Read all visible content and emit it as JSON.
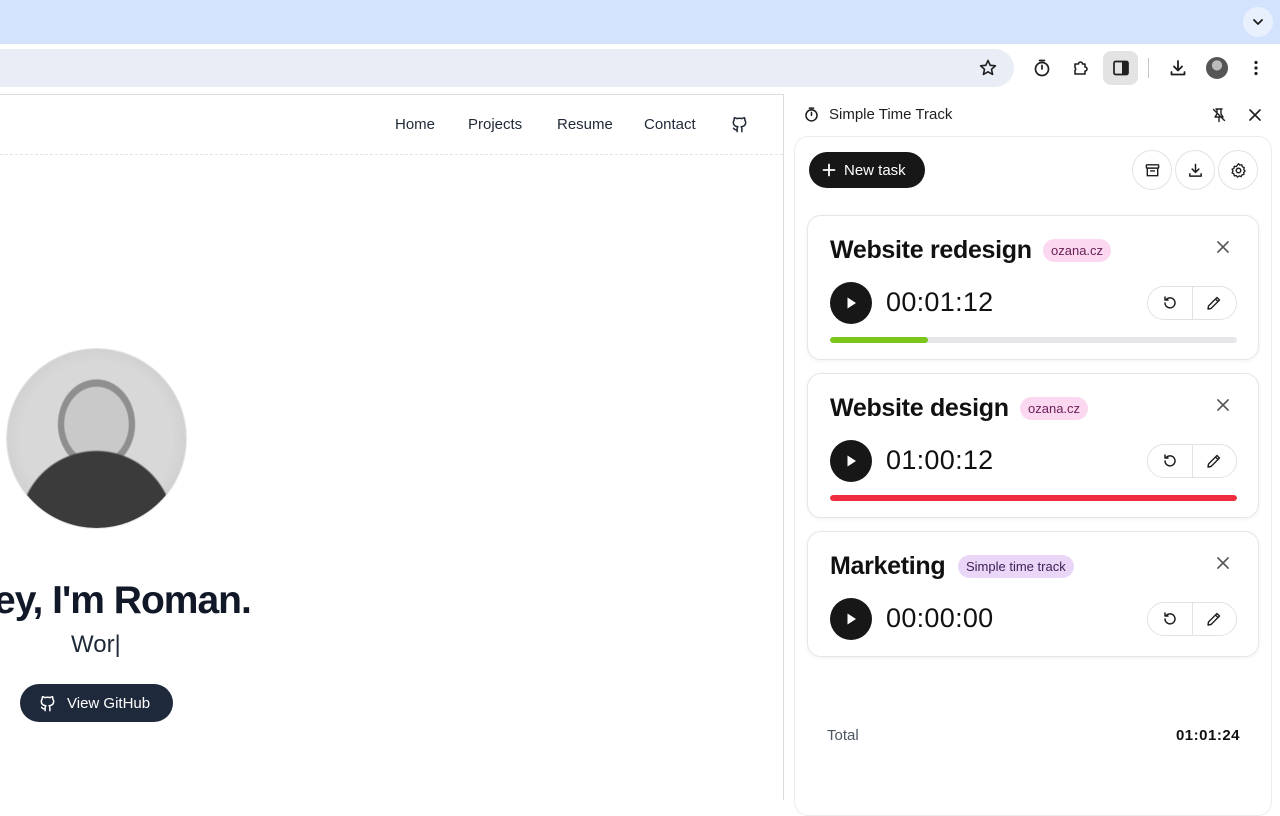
{
  "browser": {
    "toolbar_icons": [
      "star-icon",
      "timer-icon",
      "extensions-icon",
      "side-panel-icon",
      "download-icon",
      "profile-avatar",
      "more-icon"
    ]
  },
  "website": {
    "nav": [
      "Home",
      "Projects",
      "Resume",
      "Contact"
    ],
    "hero_title": "ey, I'm Roman.",
    "hero_subtitle": "Wor|",
    "github_button": "View GitHub"
  },
  "panel": {
    "title": "Simple Time Track",
    "new_task_label": "New task",
    "tasks": [
      {
        "title": "Website redesign",
        "tag": "ozana.cz",
        "time": "00:01:12",
        "progress": 0.24,
        "bar_color": "#7cc519",
        "tag_bg": "#fbd7f0",
        "tag_color": "#6b2158"
      },
      {
        "title": "Website design",
        "tag": "ozana.cz",
        "time": "01:00:12",
        "progress": 1.0,
        "bar_color": "#ef2d3e",
        "tag_bg": "#fbd7f0",
        "tag_color": "#6b2158"
      },
      {
        "title": "Marketing",
        "tag": "Simple time track",
        "time": "00:00:00",
        "progress": null,
        "tag_bg": "#ead6f7",
        "tag_color": "#3f2058"
      }
    ],
    "total_label": "Total",
    "total_value": "01:01:24"
  }
}
